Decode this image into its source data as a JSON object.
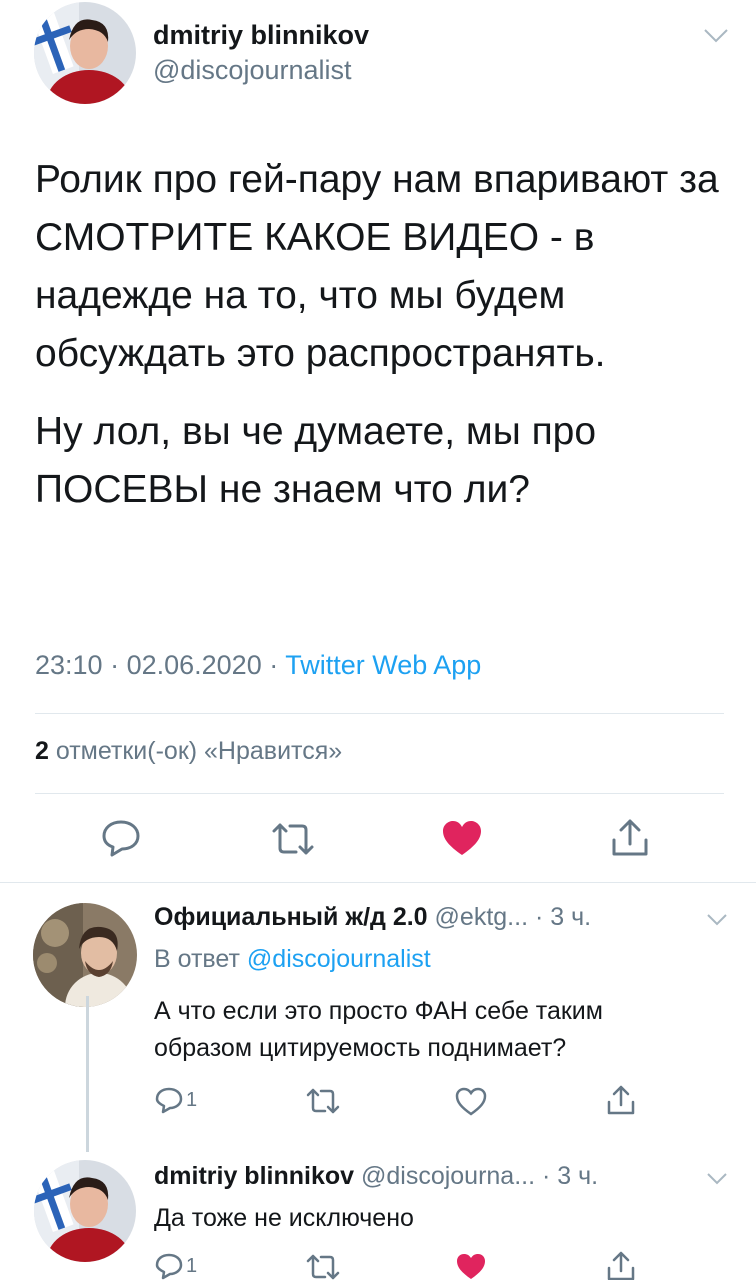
{
  "main_tweet": {
    "author_name": "dmitriy blinnikov",
    "handle": "@discojournalist",
    "paragraphs": [
      "Ролик про гей-пару нам впаривают за СМОТРИТЕ КАКОЕ ВИДЕО - в надежде на то, что мы будем обсуждать это распространять.",
      "Ну лол, вы че думаете, мы про ПОСЕВЫ не знаем что ли?"
    ],
    "time": "23:10",
    "sep1": " · ",
    "date": "02.06.2020",
    "sep2": " · ",
    "source": "Twitter Web App",
    "likes_count": "2",
    "likes_label": " отметки(-ок) «Нравится»"
  },
  "replies": [
    {
      "author_name": "Официальный ж/д 2.0",
      "handle": " @ektg...",
      "time": " · 3 ч.",
      "replying_prefix": "В ответ ",
      "replying_to": "@discojournalist",
      "text_line1": "А что если это просто ФАН себе таким",
      "text_line2": "образом цитируемость поднимает?",
      "reply_count": "1"
    },
    {
      "author_name": "dmitriy blinnikov",
      "handle": " @discojourna...",
      "time": " · 3 ч.",
      "text_line1": "Да тоже не исключено",
      "reply_count": "1"
    }
  ],
  "colors": {
    "link": "#1da1f2",
    "like_active": "#e0245e",
    "secondary_text": "#657786",
    "divider": "#e1e8ed"
  },
  "icons": {
    "reply": "speech-bubble-icon",
    "retweet": "retweet-arrows-icon",
    "like": "heart-icon",
    "share": "share-upload-icon",
    "menu": "chevron-down-icon"
  }
}
